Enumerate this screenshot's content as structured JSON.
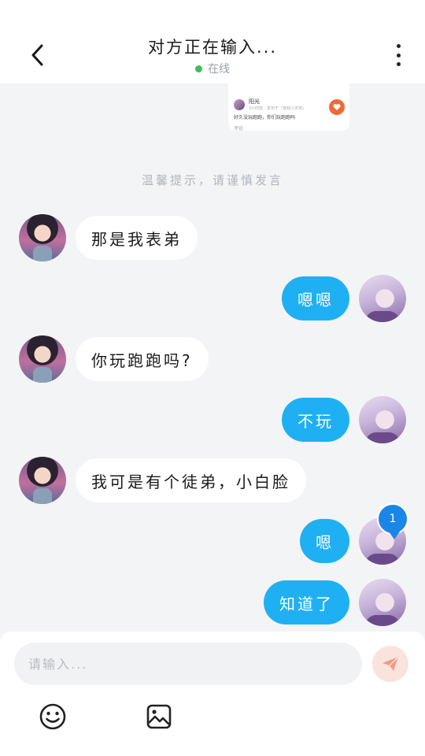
{
  "header": {
    "title": "对方正在输入...",
    "status": "在线",
    "status_color": "#3cc05a"
  },
  "shared_post": {
    "author": "阳光",
    "subtitle": "3小时前 · 发布于「游戏小天地」",
    "text": "好久没玩跑跑，你们玩跑跑吗",
    "footer": "评论",
    "badge_count": "1"
  },
  "tip": "温馨提示，请谨慎发言",
  "messages": [
    {
      "side": "left",
      "text": "那是我表弟"
    },
    {
      "side": "right",
      "text": "嗯嗯"
    },
    {
      "side": "left",
      "text": "你玩跑跑吗?"
    },
    {
      "side": "right",
      "text": "不玩"
    },
    {
      "side": "left",
      "text": "我可是有个徒弟，小白脸"
    },
    {
      "side": "right",
      "text": "嗯"
    },
    {
      "side": "right",
      "text": "知道了"
    }
  ],
  "unread_badge": "1",
  "composer": {
    "placeholder": "请输入...",
    "value": ""
  },
  "colors": {
    "accent": "#1fb0f3",
    "background": "#f3f4f6",
    "send_button_bg": "#fbe3dd",
    "send_icon": "#f29a86",
    "badge": "#1a86e8"
  },
  "icons": {
    "back": "chevron-left-icon",
    "more": "more-vertical-icon",
    "send": "paper-plane-icon",
    "emoji": "emoji-icon",
    "image": "image-icon"
  }
}
